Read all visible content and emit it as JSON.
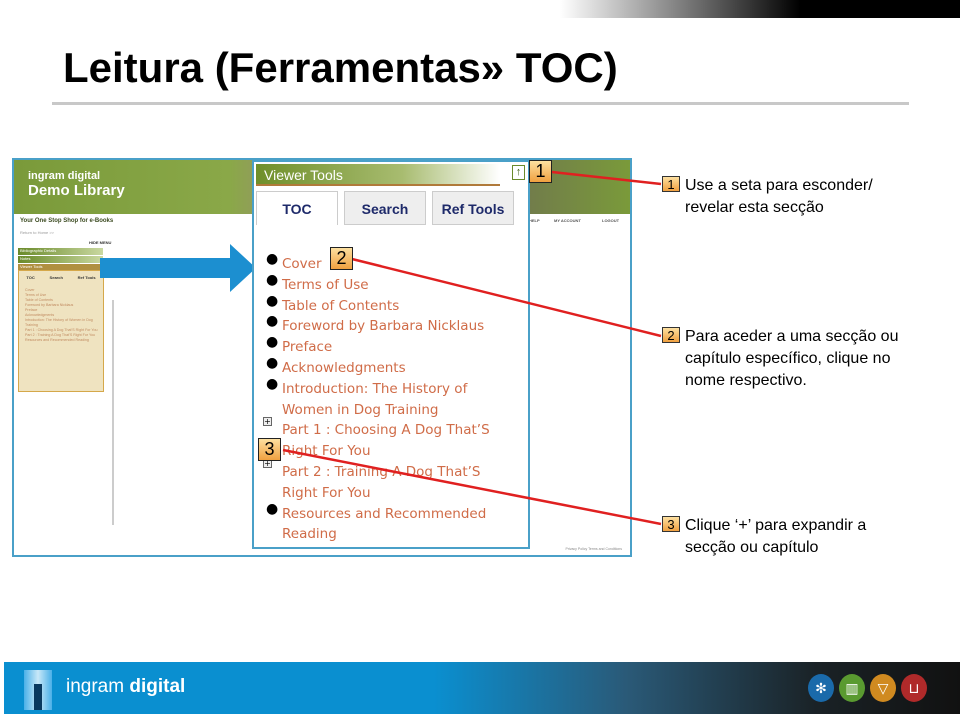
{
  "slide": {
    "title": "Leitura (Ferramentas» TOC)"
  },
  "screenshot": {
    "brand_top": "ingram digital",
    "brand_main": "Demo Library",
    "tagline": "Your One Stop Shop for e-Books",
    "return_link": "Return to Home >>",
    "hide_menu": "HIDE MENU",
    "nav": [
      "HELP",
      "MY ACCOUNT",
      "LOGOUT"
    ],
    "accordion": [
      "Bibliographic Details",
      "Notes",
      "Viewer Tools"
    ],
    "side_tabs": [
      "TOC",
      "Search",
      "Ref Tools"
    ],
    "footer_links": "Privacy Policy   Terms and Conditions"
  },
  "viewer_tools": {
    "title": "Viewer Tools",
    "collapse_icon": "arrow-up-icon",
    "tabs": [
      "TOC",
      "Search",
      "Ref Tools"
    ],
    "toc": [
      {
        "label": "Cover",
        "marker": "bullet"
      },
      {
        "label": "Terms of Use",
        "marker": "bullet"
      },
      {
        "label": "Table of Contents",
        "marker": "bullet"
      },
      {
        "label": "Foreword by Barbara Nicklaus",
        "marker": "bullet"
      },
      {
        "label": "Preface",
        "marker": "bullet"
      },
      {
        "label": "Acknowledgments",
        "marker": "bullet"
      },
      {
        "label": "Introduction: The History of Women in Dog Training",
        "marker": "bullet"
      },
      {
        "label": "Part 1 : Choosing A Dog That’S Right For You",
        "marker": "plus"
      },
      {
        "label": "Part 2 : Training A Dog That’S Right For You",
        "marker": "plus"
      },
      {
        "label": "Resources and Recommended Reading",
        "marker": "bullet"
      }
    ]
  },
  "callouts": [
    {
      "num": "1",
      "text1": "Use a seta para esconder/",
      "text2": "revelar esta secção"
    },
    {
      "num": "2",
      "text1": "Para aceder a uma secção ou",
      "text2": "capítulo específico, clique no",
      "text3": "nome respectivo."
    },
    {
      "num": "3",
      "text1": "Clique ‘+’ para expandir  a",
      "text2": "secção ou capítulo"
    }
  ],
  "footer": {
    "brand_light": "ingram",
    "brand_bold": "digital",
    "icons": [
      "gear-icon",
      "book-icon",
      "download-icon",
      "cart-icon"
    ]
  },
  "colors": {
    "accent_green": "#7a9a3a",
    "link": "#d06c48",
    "callout_line": "#e02020",
    "footer_blue": "#0a8fd0"
  }
}
